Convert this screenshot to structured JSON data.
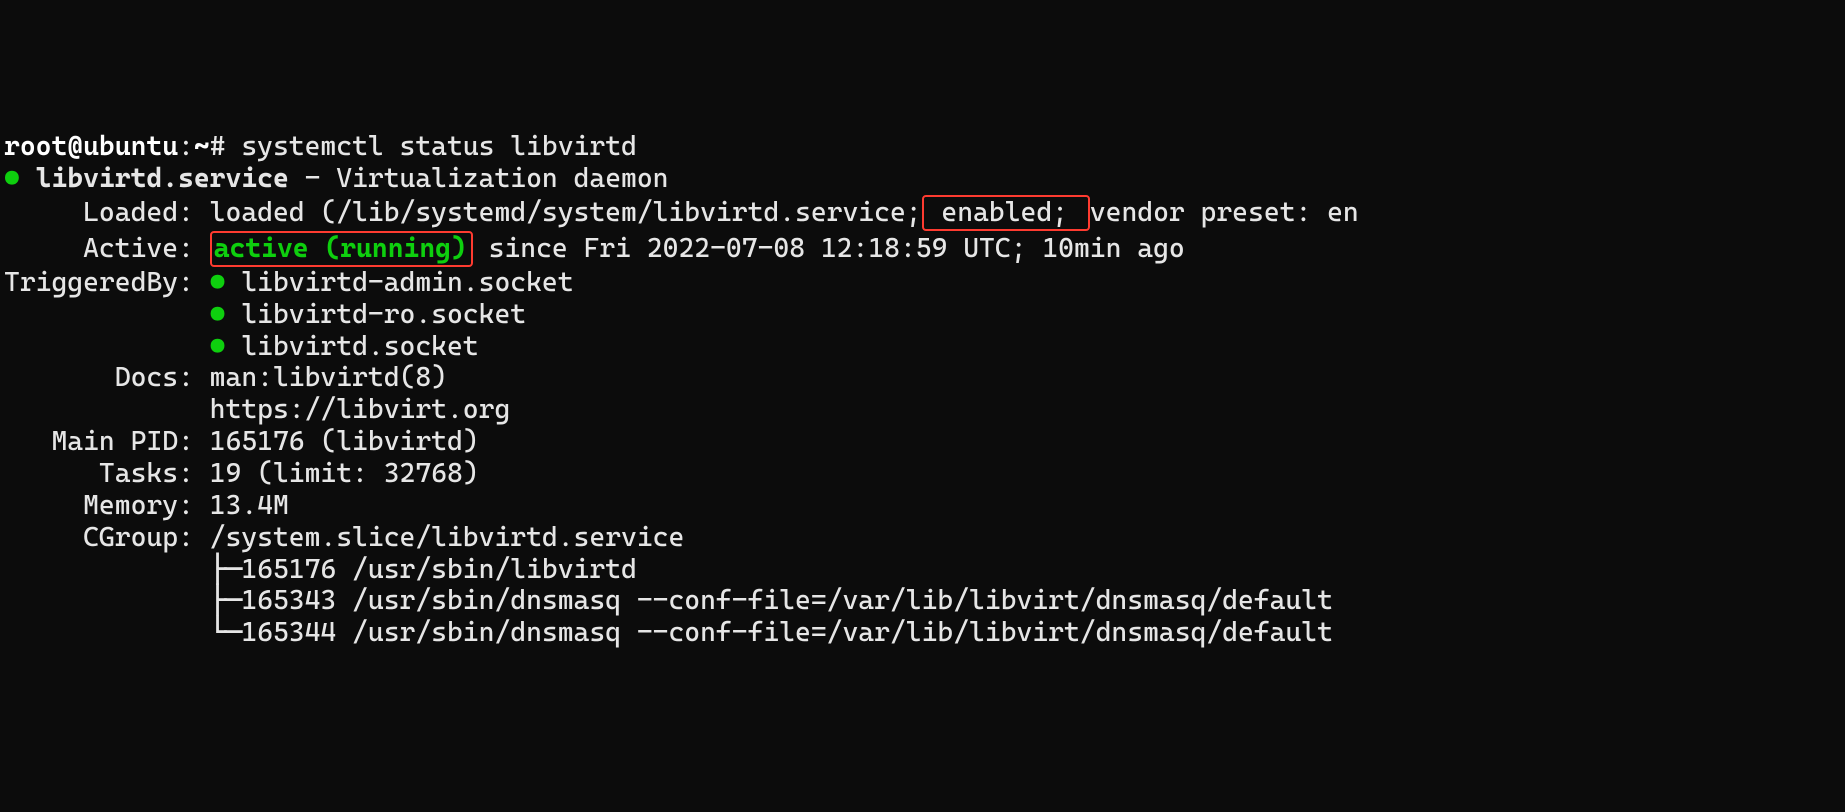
{
  "prompt": {
    "user": "root",
    "at": "@",
    "host": "ubuntu",
    "colon": ":",
    "path": "~",
    "hash": "# ",
    "command": "systemctl status libvirtd"
  },
  "dot": "●",
  "unit_line": {
    "name": "libvirtd.service",
    "dash": " - ",
    "desc": "Virtualization daemon"
  },
  "loaded": {
    "label": "     Loaded: ",
    "pre": "loaded (/lib/systemd/system/libvirtd.service;",
    "enabled": " enabled; ",
    "post": "vendor preset: en"
  },
  "active": {
    "label": "     Active: ",
    "status": "active (running)",
    "since": " since Fri 2022-07-08 12:18:59 UTC; 10min ago"
  },
  "triggered": {
    "label": "TriggeredBy: ",
    "s1": " libvirtd-admin.socket",
    "pad": "             ",
    "s2": " libvirtd-ro.socket",
    "s3": " libvirtd.socket"
  },
  "docs": {
    "label": "       Docs: ",
    "l1": "man:libvirtd(8)",
    "pad": "             ",
    "l2": "https://libvirt.org"
  },
  "mainpid": {
    "label": "   Main PID: ",
    "val": "165176 (libvirtd)"
  },
  "tasks": {
    "label": "      Tasks: ",
    "val": "19 (limit: 32768)"
  },
  "memory": {
    "label": "     Memory: ",
    "val": "13.4M"
  },
  "cgroup": {
    "label": "     CGroup: ",
    "path": "/system.slice/libvirtd.service",
    "pad": "             ",
    "t1a": "├─",
    "t1b": "165176 /usr/sbin/libvirtd",
    "t2a": "├─",
    "t2b": "165343 /usr/sbin/dnsmasq --conf-file=/var/lib/libvirt/dnsmasq/default",
    "t3a": "└─",
    "t3b": "165344 /usr/sbin/dnsmasq --conf-file=/var/lib/libvirt/dnsmasq/default"
  }
}
